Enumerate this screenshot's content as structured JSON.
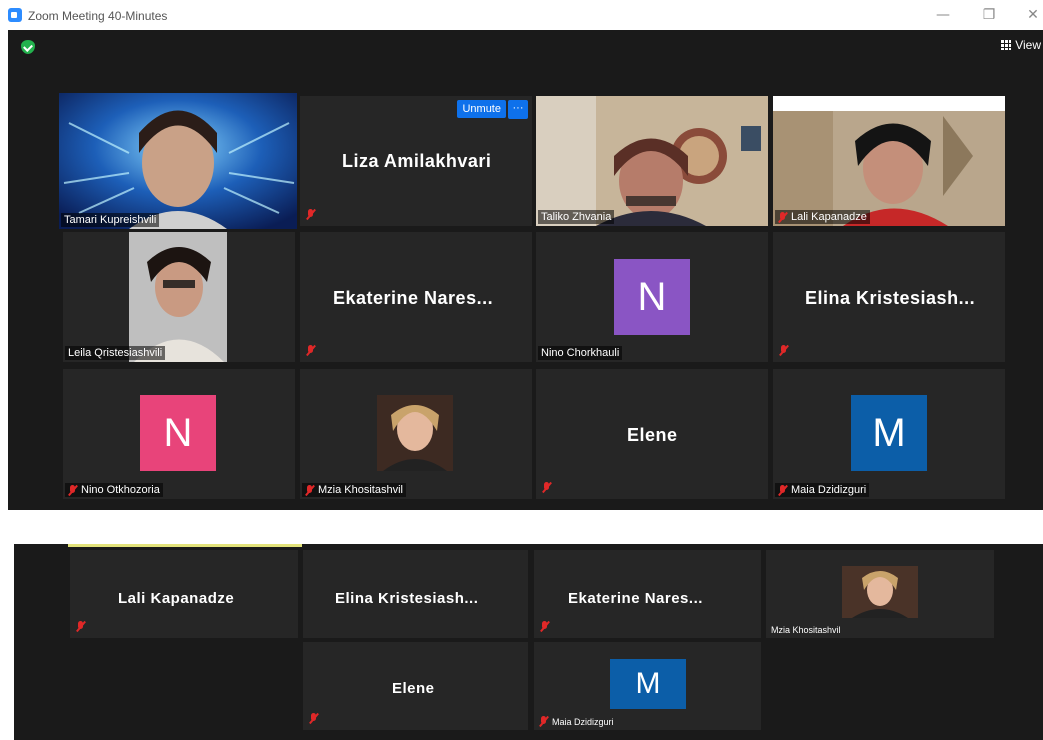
{
  "window": {
    "title": "Zoom Meeting 40-Minutes",
    "minimize": "—",
    "restore": "❐",
    "close": "✕"
  },
  "toolbar": {
    "view_label": "View"
  },
  "top_grid": {
    "tile_1": {
      "label": "Tamari Kupreishvili"
    },
    "tile_2": {
      "name": "Liza Amilakhvari",
      "unmute": "Unmute",
      "more": "···"
    },
    "tile_3": {
      "label": "Taliko Zhvania"
    },
    "tile_4": {
      "label": "Lali Kapanadze"
    },
    "tile_5": {
      "label": "Leila Qristesiashvili"
    },
    "tile_6": {
      "name": "Ekaterine  Nares..."
    },
    "tile_7": {
      "initial": "N",
      "label": "Nino Chorkhauli"
    },
    "tile_8": {
      "name": "Elina  Kristesiash..."
    },
    "tile_9": {
      "initial": "N",
      "label": "Nino Otkhozoria"
    },
    "tile_10": {
      "label": "Mzia Khositashvil"
    },
    "tile_11": {
      "name": "Elene"
    },
    "tile_12": {
      "initial": "M",
      "label": "Maia Dzidizguri"
    }
  },
  "bottom_grid": {
    "tile_1": {
      "name": "Lali Kapanadze"
    },
    "tile_2": {
      "name": "Elina  Kristesiash..."
    },
    "tile_3": {
      "name": "Ekaterine  Nares..."
    },
    "tile_4": {
      "label": "Mzia Khositashvil"
    },
    "tile_5": {
      "name": "Elene"
    },
    "tile_6": {
      "initial": "M",
      "label": "Maia Dzidizguri"
    }
  },
  "colors": {
    "avatar_purple": "#8a55c4",
    "avatar_pink": "#e8447a",
    "avatar_blue": "#0c5ea8",
    "active_border": "#e2e27a",
    "unmute_blue": "#0e71eb",
    "muted_red": "#e02828"
  }
}
